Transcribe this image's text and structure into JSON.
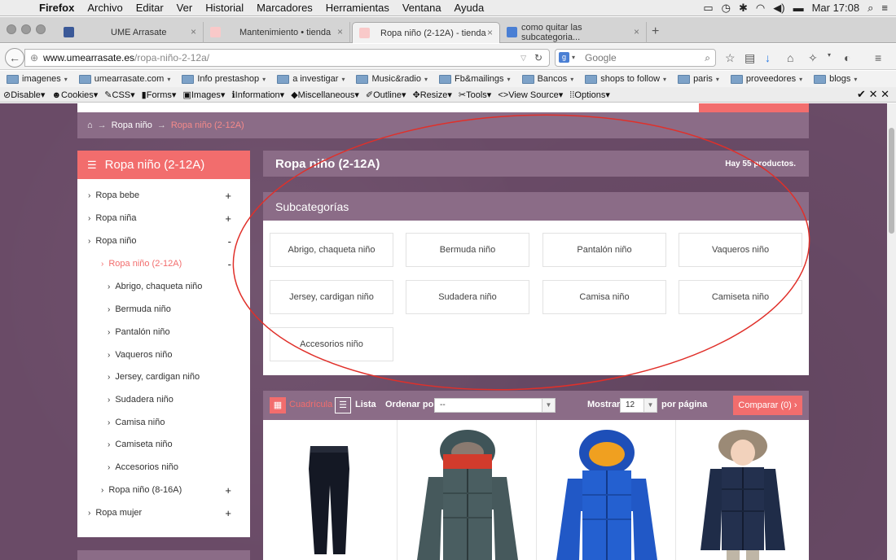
{
  "menubar": {
    "app": "Firefox",
    "items": [
      "Archivo",
      "Editar",
      "Ver",
      "Historial",
      "Marcadores",
      "Herramientas",
      "Ventana",
      "Ayuda"
    ],
    "clock": "Mar 17:08"
  },
  "tabs": [
    {
      "label": "UME Arrasate",
      "color": "#3b5998"
    },
    {
      "label": "Mantenimiento • tienda",
      "color": "#f26d6d"
    },
    {
      "label": "Ropa niño (2-12A) - tienda",
      "color": "#f26d6d"
    },
    {
      "label": "como quitar las subcategoria...",
      "color": "#4a7fd4"
    }
  ],
  "nav": {
    "url_host": "www.umearrasate.es",
    "url_path": "/ropa-niño-2-12a/",
    "search_placeholder": "Google"
  },
  "bookmarks": [
    "imagenes",
    "umearrasate.com",
    "Info prestashop",
    "a investigar",
    "Music&radio",
    "Fb&mailings",
    "Bancos",
    "shops to follow",
    "paris",
    "proveedores",
    "blogs"
  ],
  "devtoolbar": [
    "Disable",
    "Cookies",
    "CSS",
    "Forms",
    "Images",
    "Information",
    "Miscellaneous",
    "Outline",
    "Resize",
    "Tools",
    "View Source",
    "Options"
  ],
  "breadcrumb": {
    "level1": "Ropa niño",
    "current": "Ropa niño (2-12A)"
  },
  "sidebar": {
    "title": "Ropa niño (2-12A)",
    "items": [
      {
        "label": "Ropa bebe",
        "toggle": "+"
      },
      {
        "label": "Ropa niña",
        "toggle": "+"
      },
      {
        "label": "Ropa niño",
        "toggle": "-"
      },
      {
        "label": "Ropa niño (2-12A)",
        "toggle": "-"
      },
      {
        "label": "Abrigo, chaqueta niño",
        "toggle": ""
      },
      {
        "label": "Bermuda niño",
        "toggle": ""
      },
      {
        "label": "Pantalón niño",
        "toggle": ""
      },
      {
        "label": "Vaqueros niño",
        "toggle": ""
      },
      {
        "label": "Jersey, cardigan niño",
        "toggle": ""
      },
      {
        "label": "Sudadera niño",
        "toggle": ""
      },
      {
        "label": "Camisa niño",
        "toggle": ""
      },
      {
        "label": "Camiseta niño",
        "toggle": ""
      },
      {
        "label": "Accesorios niño",
        "toggle": ""
      },
      {
        "label": "Ropa niño (8-16A)",
        "toggle": "+"
      },
      {
        "label": "Ropa mujer",
        "toggle": "+"
      }
    ]
  },
  "category": {
    "title": "Ropa niño (2-12A)",
    "count": "Hay 55 productos."
  },
  "subcategories": {
    "title": "Subcategorías",
    "items": [
      "Abrigo, chaqueta niño",
      "Bermuda niño",
      "Pantalón niño",
      "Vaqueros niño",
      "Jersey, cardigan niño",
      "Sudadera niño",
      "Camisa niño",
      "Camiseta niño",
      "Accesorios niño"
    ]
  },
  "toolbar": {
    "grid_label": "Cuadrícula",
    "list_label": "Lista",
    "order_label": "Ordenar por",
    "order_value": "--",
    "show_label": "Mostrar",
    "show_value": "12",
    "per_page": "por página",
    "compare": "Comparar (0)"
  },
  "products": [
    "jeans-icon",
    "green-puffer-jacket-icon",
    "blue-puffer-jacket-icon",
    "navy-parka-icon"
  ]
}
